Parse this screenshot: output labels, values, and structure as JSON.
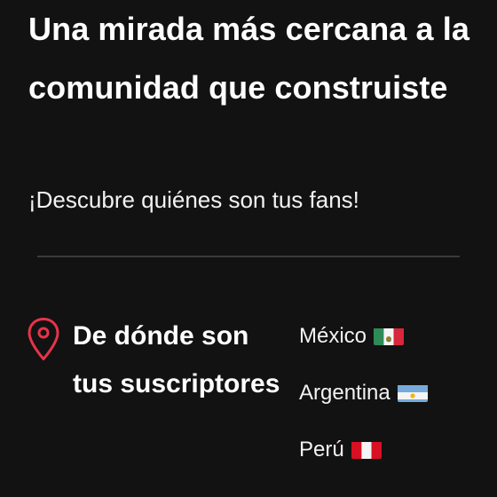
{
  "header": {
    "headline": "Una mirada más cercana a la comunidad que construiste",
    "subtitle": "¡Descubre quiénes son tus fans!"
  },
  "subscribers_section": {
    "icon": "location-pin-icon",
    "title": "De dónde son tus suscriptores",
    "countries": [
      {
        "name": "México",
        "flag_icon": "mexico-flag-icon"
      },
      {
        "name": "Argentina",
        "flag_icon": "argentina-flag-icon"
      },
      {
        "name": "Perú",
        "flag_icon": "peru-flag-icon"
      }
    ]
  },
  "colors": {
    "background": "#121212",
    "text": "#ffffff",
    "accent_red": "#e8334a",
    "divider": "#3a3a3a"
  }
}
